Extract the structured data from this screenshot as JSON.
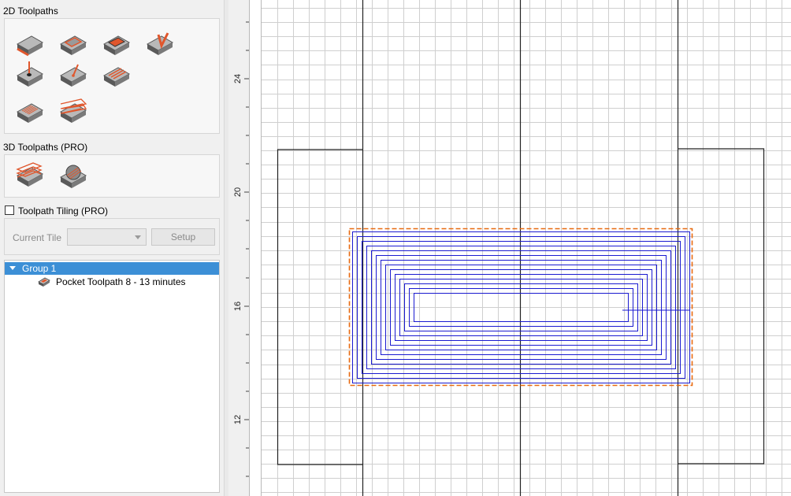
{
  "left_panel": {
    "toolpaths_2d": {
      "title": "2D Toolpaths",
      "tools": [
        {
          "name": "profile-toolpath-icon"
        },
        {
          "name": "pocket-toolpath-icon"
        },
        {
          "name": "quick-engrave-toolpath-icon"
        },
        {
          "name": "v-carve-toolpath-icon"
        },
        {
          "name": "drilling-toolpath-icon"
        },
        {
          "name": "inlay-toolpath-icon"
        },
        {
          "name": "texture-toolpath-icon"
        },
        {
          "name": "fluting-toolpath-icon"
        },
        {
          "name": "prism-carving-toolpath-icon"
        }
      ]
    },
    "toolpaths_3d": {
      "title": "3D Toolpaths (PRO)",
      "tools": [
        {
          "name": "3d-roughing-toolpath-icon"
        },
        {
          "name": "3d-finishing-toolpath-icon"
        }
      ]
    },
    "tiling": {
      "label": "Toolpath Tiling (PRO)",
      "checked": false,
      "current_tile_label": "Current Tile",
      "current_tile_value": "",
      "setup_label": "Setup"
    },
    "tree": {
      "group_label": "Group 1",
      "toolpath_label": "Pocket Toolpath 8 - 13 minutes"
    }
  },
  "ruler": {
    "labels": [
      "24",
      "20",
      "16",
      "12"
    ]
  },
  "colors": {
    "toolpath": "#1a1ad0",
    "boundary": "#e86a10",
    "selection": "#3c8fd6",
    "tool_accent": "#e0562c"
  }
}
